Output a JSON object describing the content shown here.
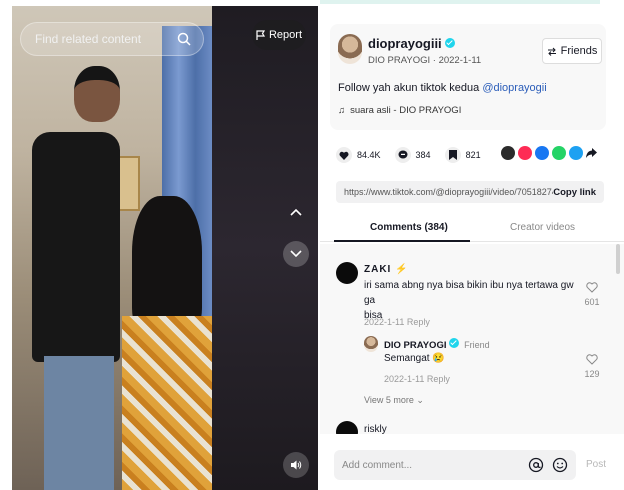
{
  "video": {
    "search_placeholder": "Find related content",
    "report_label": "Report"
  },
  "author": {
    "username": "dioprayogiii",
    "display_name": "DIO PRAYOGI",
    "separator": " · ",
    "date": "2022-1-11",
    "friends_label": "Friends",
    "caption_text": "Follow yah akun tiktok kedua ",
    "caption_mention": "@dioprayogii",
    "music": "suara asli - DIO PRAYOGI"
  },
  "stats": {
    "likes": "84.4K",
    "comments": "384",
    "saves": "821"
  },
  "share_colors": [
    "#2b2b2b",
    "#fe2c55",
    "#1877f2",
    "#25d366",
    "#1da1f2",
    "#161823"
  ],
  "link": {
    "url": "https://www.tiktok.com/@dioprayogiii/video/70518274...",
    "copy_label": "Copy link"
  },
  "tabs": {
    "comments": "Comments (384)",
    "creator": "Creator videos"
  },
  "comments": [
    {
      "user": "ZAKI",
      "user_emoji": "⚡",
      "text_line1": "iri sama abng nya bisa bikin ibu nya tertawa gw ga",
      "text_line2": "bisa",
      "date": "2022-1-11",
      "reply_label": "Reply",
      "likes": "601",
      "reply": {
        "user": "DIO PRAYOGI",
        "tag": "Friend",
        "text": "Semangat 😢",
        "date": "2022-1-11",
        "reply_label": "Reply",
        "likes": "129"
      },
      "view_more": "View 5 more"
    },
    {
      "user": "riskly"
    }
  ],
  "footer": {
    "placeholder": "Add comment...",
    "post_label": "Post"
  }
}
